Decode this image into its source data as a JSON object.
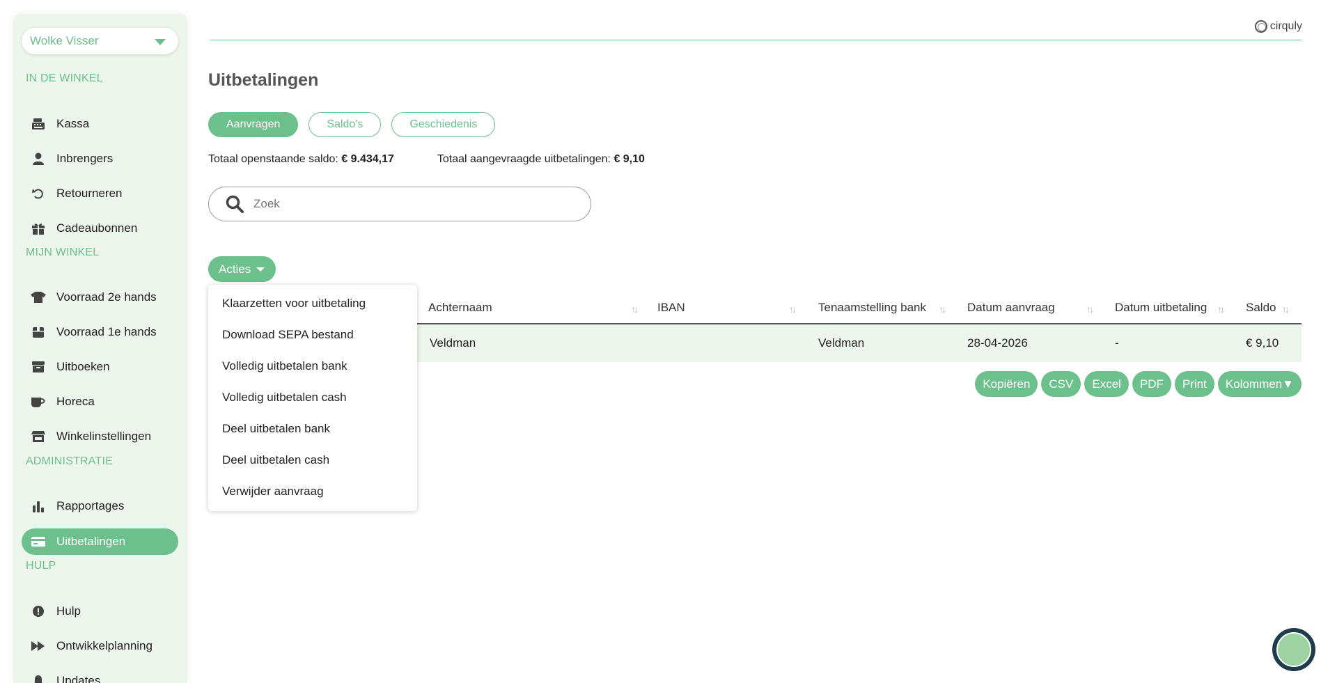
{
  "sidebar": {
    "user": "Wolke Visser",
    "sections": {
      "in_de_winkel": "IN DE WINKEL",
      "mijn_winkel": "MIJN WINKEL",
      "administratie": "ADMINISTRATIE",
      "hulp": "HULP"
    },
    "items": [
      {
        "label": "Kassa",
        "icon": "cash-register-icon"
      },
      {
        "label": "Inbrengers",
        "icon": "user-icon"
      },
      {
        "label": "Retourneren",
        "icon": "undo-icon"
      },
      {
        "label": "Cadeaubonnen",
        "icon": "gift-icon"
      },
      {
        "label": "Voorraad 2e hands",
        "icon": "shirt-icon"
      },
      {
        "label": "Voorraad 1e hands",
        "icon": "box-icon"
      },
      {
        "label": "Uitboeken",
        "icon": "archive-icon"
      },
      {
        "label": "Horeca",
        "icon": "coffee-icon"
      },
      {
        "label": "Winkelinstellingen",
        "icon": "store-icon"
      },
      {
        "label": "Rapportages",
        "icon": "bar-chart-icon"
      },
      {
        "label": "Uitbetalingen",
        "icon": "credit-card-icon",
        "active": true
      },
      {
        "label": "Hulp",
        "icon": "alert-circle-icon"
      },
      {
        "label": "Ontwikkelplanning",
        "icon": "fast-forward-icon"
      },
      {
        "label": "Updates",
        "icon": "bell-icon"
      }
    ]
  },
  "brand": "cirquly",
  "page": {
    "title": "Uitbetalingen",
    "tabs": [
      "Aanvragen",
      "Saldo's",
      "Geschiedenis"
    ],
    "active_tab": "Aanvragen",
    "totals": {
      "open_label": "Totaal openstaande saldo:",
      "open_value": "€ 9.434,17",
      "requested_label": "Totaal aangevraagde uitbetalingen:",
      "requested_value": "€ 9,10"
    },
    "search": {
      "placeholder": "Zoek",
      "value": ""
    },
    "actions_label": "Acties"
  },
  "actions_menu": [
    "Klaarzetten voor uitbetaling",
    "Download SEPA bestand",
    "Volledig uitbetalen bank",
    "Volledig uitbetalen cash",
    "Deel uitbetalen bank",
    "Deel uitbetalen cash",
    "Verwijder aanvraag"
  ],
  "table": {
    "columns": [
      "Achternaam",
      "IBAN",
      "Tenaamstelling bank",
      "Datum aanvraag",
      "Datum uitbetaling",
      "Saldo"
    ],
    "rows": [
      {
        "achternaam": "Veldman",
        "iban": "",
        "tenaamstelling": "Veldman",
        "datum_aanvraag": "28-04-2026",
        "datum_uitbetaling": "-",
        "saldo": "€ 9,10"
      }
    ]
  },
  "export_buttons": [
    "Kopiëren",
    "CSV",
    "Excel",
    "PDF",
    "Print",
    "Kolommen▼"
  ],
  "colors": {
    "accent": "#6cc08c",
    "sidebar_bg": "#edf6ec",
    "row_bg": "#edf6ec"
  }
}
